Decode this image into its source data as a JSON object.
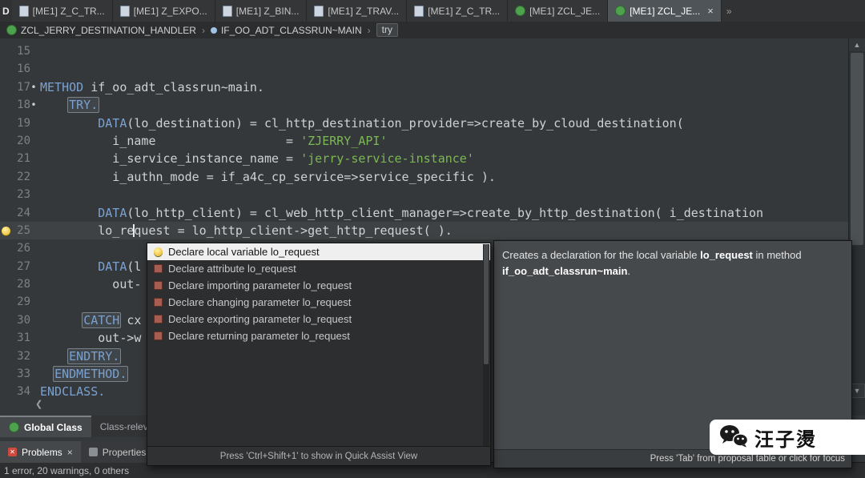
{
  "colors": {
    "keyword": "#7ba1d0",
    "string": "#7cb854",
    "code_text": "#ced2d5",
    "selection_bg": "#efefef",
    "bulb": "#f2c94c",
    "class_green": "#4ea24e",
    "error_red": "#cf4a3e"
  },
  "icons": {
    "crumb_sep": "›",
    "marker_dot": "•",
    "scroll_up": "▲",
    "scroll_down": "▼",
    "scroll_left": "❮",
    "problems_glyph": "✕"
  },
  "tab_bar": {
    "corner_glyph": "D",
    "overflow_glyph": "»",
    "tabs": [
      {
        "label": "[ME1] Z_C_TR...",
        "icon": "program",
        "active": false
      },
      {
        "label": "[ME1] Z_EXPO...",
        "icon": "program",
        "active": false
      },
      {
        "label": "[ME1] Z_BIN...",
        "icon": "program",
        "active": false
      },
      {
        "label": "[ME1] Z_TRAV...",
        "icon": "program",
        "active": false
      },
      {
        "label": "[ME1] Z_C_TR...",
        "icon": "program",
        "active": false
      },
      {
        "label": "[ME1] ZCL_JE...",
        "icon": "class",
        "active": false
      },
      {
        "label": "[ME1] ZCL_JE...",
        "icon": "class",
        "active": true,
        "close": "×"
      }
    ]
  },
  "breadcrumb": {
    "items": [
      {
        "label": "ZCL_JERRY_DESTINATION_HANDLER",
        "icon": "class"
      },
      {
        "label": "IF_OO_ADT_CLASSRUN~MAIN",
        "icon": "method"
      },
      {
        "label": "try",
        "icon": "chip"
      }
    ]
  },
  "editor": {
    "lines": [
      {
        "n": 15,
        "s": []
      },
      {
        "n": 16,
        "s": []
      },
      {
        "n": 17,
        "marker": "dot",
        "s": [
          [
            "k",
            "METHOD"
          ],
          [
            "t",
            " if_oo_adt_classrun~main."
          ]
        ]
      },
      {
        "n": 18,
        "marker": "dot",
        "s": [
          [
            "t",
            "    "
          ],
          [
            "b",
            "TRY."
          ]
        ]
      },
      {
        "n": 19,
        "s": [
          [
            "t",
            "        "
          ],
          [
            "k",
            "DATA"
          ],
          [
            "t",
            "(lo_destination) = cl_http_destination_provider=>create_by_cloud_destination("
          ]
        ]
      },
      {
        "n": 20,
        "s": [
          [
            "t",
            "          i_name                  = "
          ],
          [
            "s2",
            "'ZJERRY_API'"
          ]
        ]
      },
      {
        "n": 21,
        "s": [
          [
            "t",
            "          i_service_instance_name = "
          ],
          [
            "s2",
            "'jerry-service-instance'"
          ]
        ]
      },
      {
        "n": 22,
        "s": [
          [
            "t",
            "          i_authn_mode = if_a4c_cp_service=>service_specific )."
          ]
        ]
      },
      {
        "n": 23,
        "s": []
      },
      {
        "n": 24,
        "s": [
          [
            "t",
            "        "
          ],
          [
            "k",
            "DATA"
          ],
          [
            "t",
            "(lo_http_client) = cl_web_http_client_manager=>create_by_http_destination( i_destination"
          ]
        ]
      },
      {
        "n": 25,
        "marker": "bulb",
        "current": true,
        "s": [
          [
            "t",
            "        lo_re"
          ],
          [
            "c",
            ""
          ],
          [
            "t",
            "quest = lo_http_client->get_http_request( )."
          ]
        ]
      },
      {
        "n": 26,
        "s": []
      },
      {
        "n": 27,
        "s": [
          [
            "t",
            "        "
          ],
          [
            "k",
            "DATA"
          ],
          [
            "t",
            "(l"
          ]
        ]
      },
      {
        "n": 28,
        "s": [
          [
            "t",
            "          out-"
          ]
        ]
      },
      {
        "n": 29,
        "s": []
      },
      {
        "n": 30,
        "s": [
          [
            "t",
            "      "
          ],
          [
            "b",
            "CATCH"
          ],
          [
            "t",
            " cx"
          ]
        ]
      },
      {
        "n": 31,
        "s": [
          [
            "t",
            "        out->w"
          ]
        ]
      },
      {
        "n": 32,
        "s": [
          [
            "t",
            "    "
          ],
          [
            "b",
            "ENDTRY."
          ]
        ]
      },
      {
        "n": 33,
        "s": [
          [
            "t",
            "  "
          ],
          [
            "b",
            "ENDMETHOD."
          ]
        ]
      },
      {
        "n": 34,
        "s": [
          [
            "k",
            "ENDCLASS."
          ]
        ]
      }
    ]
  },
  "quick_assist": {
    "items": [
      {
        "label": "Declare local variable lo_request",
        "icon": "bulb",
        "selected": true
      },
      {
        "label": "Declare attribute lo_request",
        "icon": "proposal",
        "selected": false
      },
      {
        "label": "Declare importing parameter lo_request",
        "icon": "proposal",
        "selected": false
      },
      {
        "label": "Declare changing parameter lo_request",
        "icon": "proposal",
        "selected": false
      },
      {
        "label": "Declare exporting parameter lo_request",
        "icon": "proposal",
        "selected": false
      },
      {
        "label": "Declare returning parameter lo_request",
        "icon": "proposal",
        "selected": false
      }
    ],
    "hint": "Press 'Ctrl+Shift+1' to show in Quick Assist View"
  },
  "proposal_info": {
    "parts": [
      {
        "t": "Creates a declaration for the local variable "
      },
      {
        "t": "lo_request",
        "b": true
      },
      {
        "t": " in method "
      },
      {
        "t": "if_oo_adt_classrun~main",
        "b": true
      },
      {
        "t": "."
      }
    ],
    "hint": "Press 'Tab' from proposal table or click for focus"
  },
  "view_tabs": [
    {
      "label": "Global Class",
      "icon": "class",
      "active": true
    },
    {
      "label": "Class-releva",
      "icon": "",
      "active": false
    }
  ],
  "panel_tabs": [
    {
      "label": "Problems",
      "icon": "problems",
      "active": true,
      "close": "×"
    },
    {
      "label": "Properties",
      "icon": "properties",
      "active": false
    }
  ],
  "status_bar": {
    "text": "1 error, 20 warnings, 0 others"
  },
  "watermark": {
    "text": "汪子燙"
  }
}
